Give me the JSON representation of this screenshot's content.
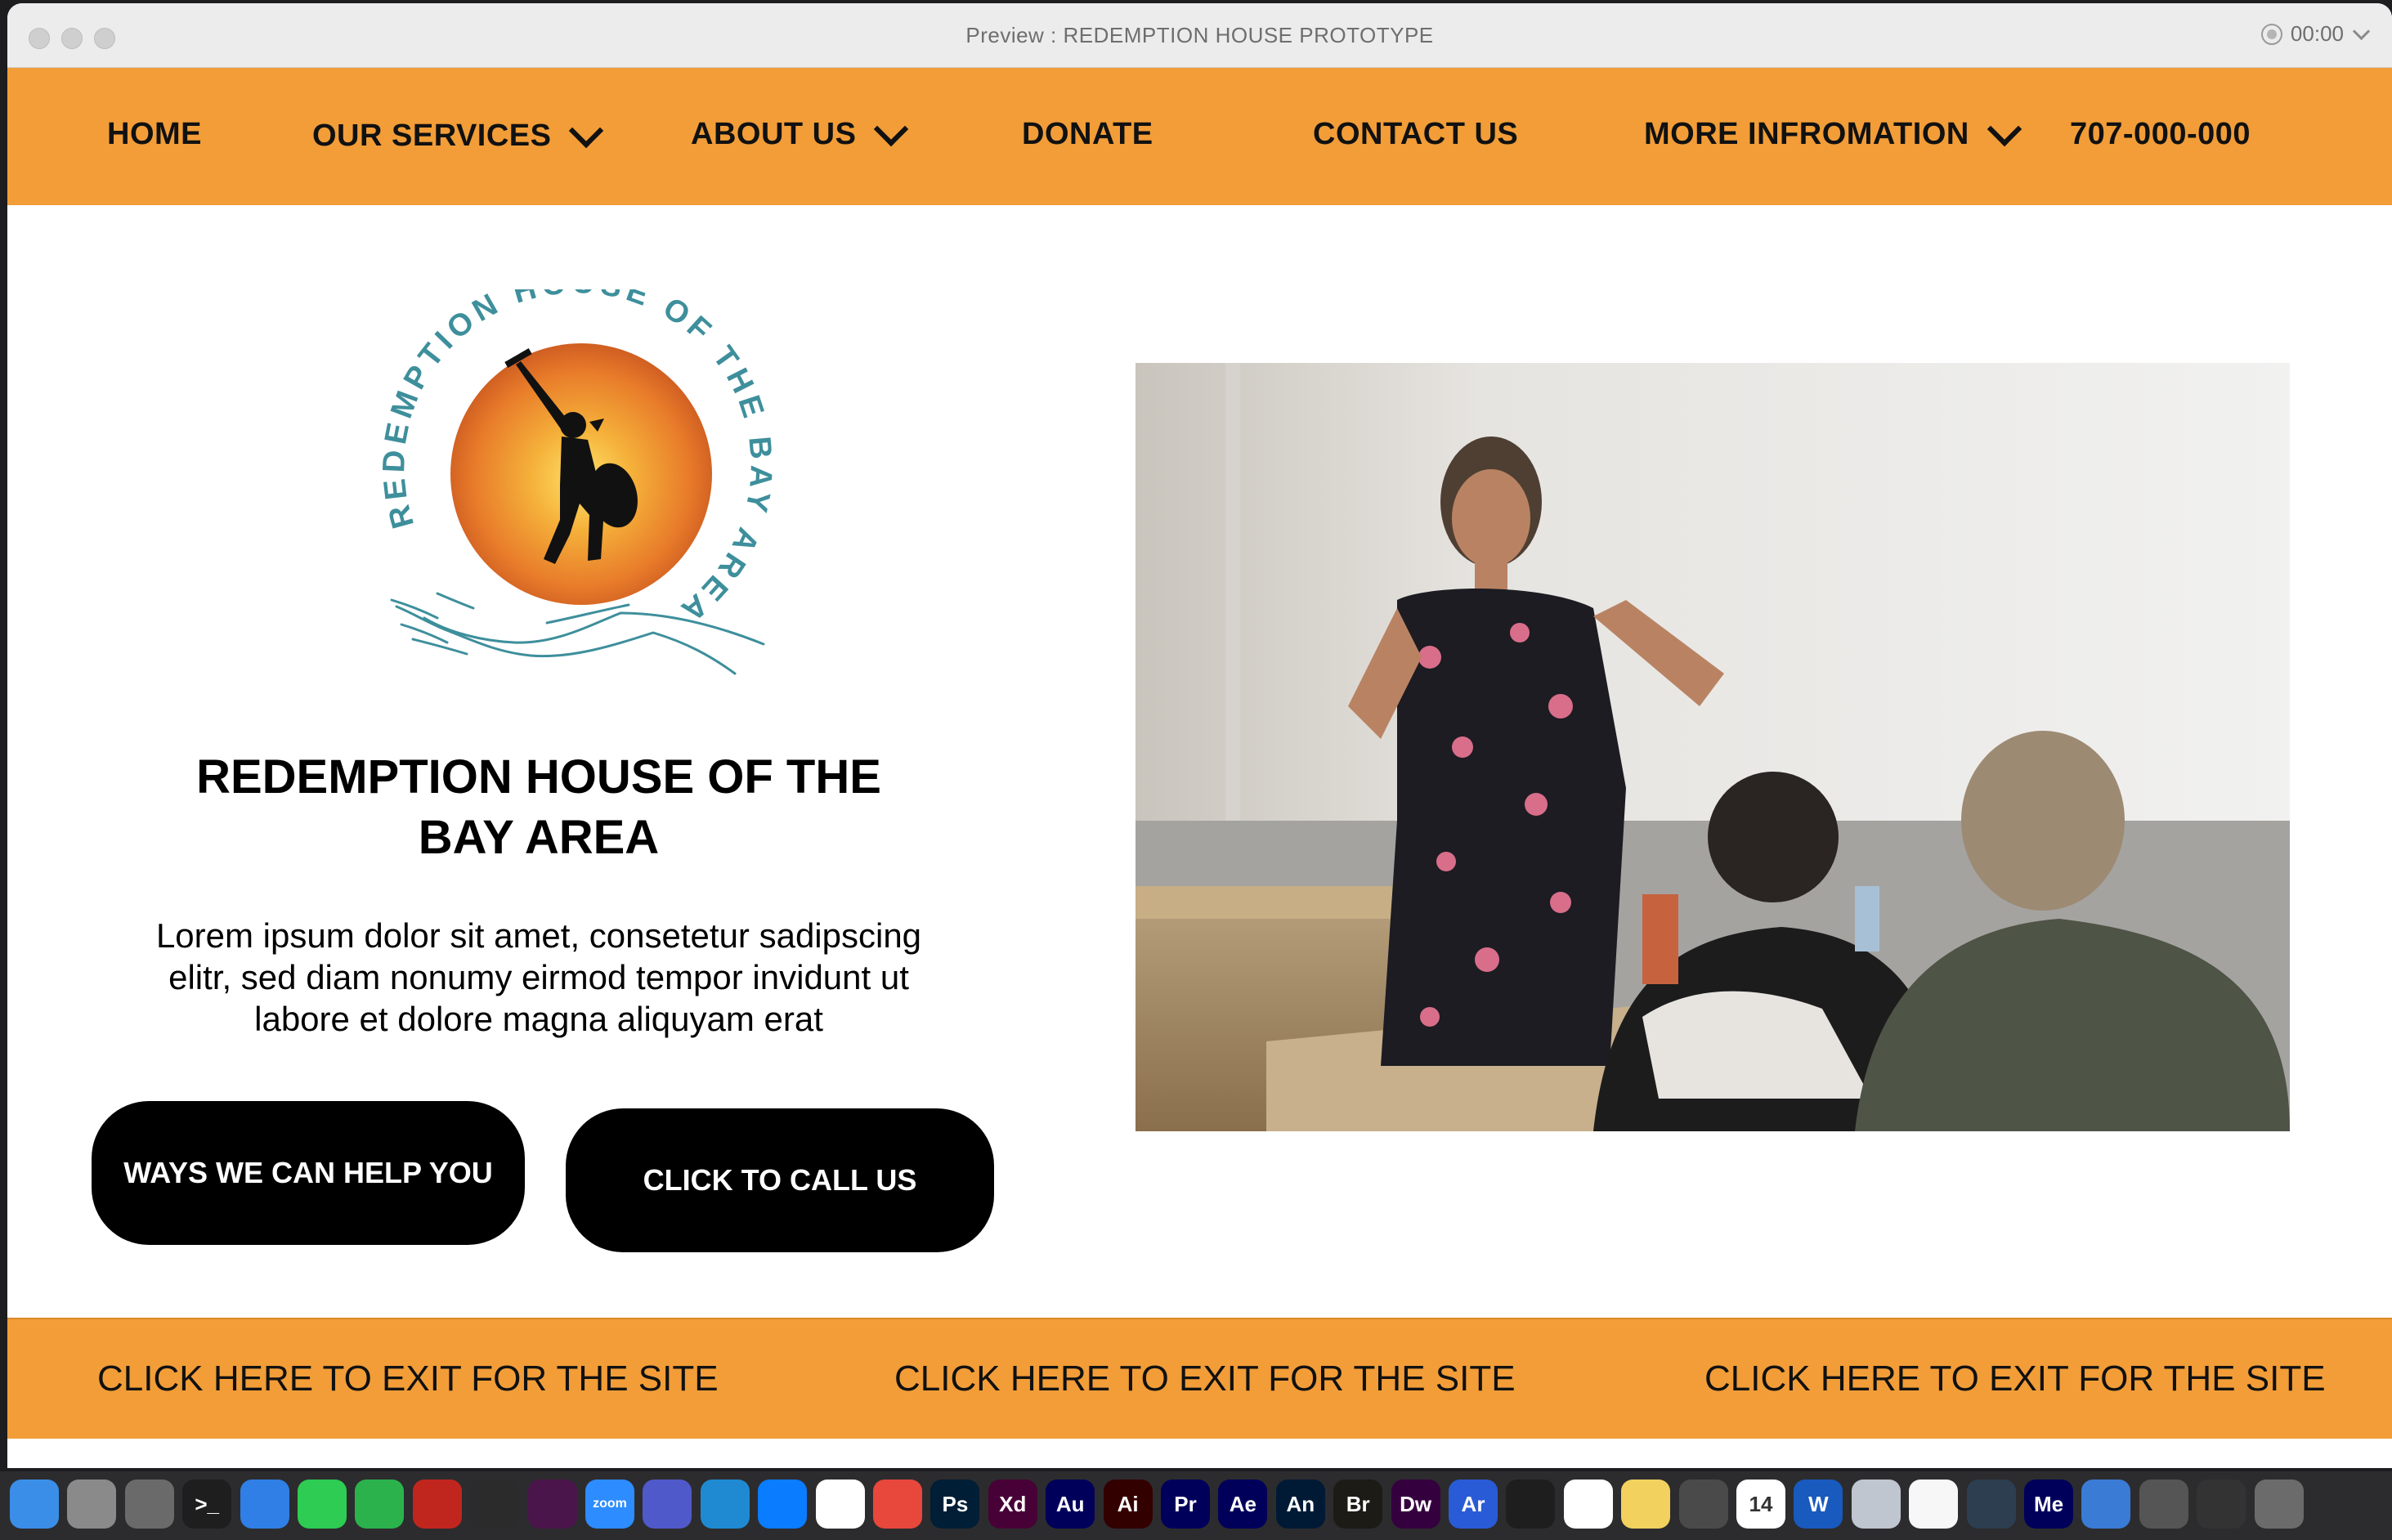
{
  "window": {
    "title": "Preview : REDEMPTION HOUSE PROTOTYPE",
    "timer": "00:00"
  },
  "nav": {
    "home": "HOME",
    "services": "OUR SERVICES",
    "about": "ABOUT US",
    "donate": "DONATE",
    "contact": "CONTACT US",
    "more": "MORE INFROMATION",
    "phone": "707-000-000"
  },
  "logo": {
    "ring_text": "REDEMPTION HOUSE OF THE BAY AREA"
  },
  "hero": {
    "title_line1": "REDEMPTION HOUSE OF THE",
    "title_line2": "BAY AREA",
    "desc_line1": "Lorem ipsum dolor sit amet, consetetur sadipscing",
    "desc_line2": "elitr, sed diam nonumy eirmod tempor invidunt ut",
    "desc_line3": "labore et dolore magna aliquyam erat",
    "help_button": "WAYS WE CAN HELP YOU",
    "call_button": "CLICK TO CALL US"
  },
  "footer": {
    "exit_1": "CLICK HERE TO EXIT FOR THE SITE",
    "exit_2": "CLICK HERE TO EXIT FOR THE SITE",
    "exit_3": "CLICK HERE TO EXIT FOR THE SITE"
  },
  "colors": {
    "accent": "#f29d38",
    "button": "#000000",
    "logo_teal": "#3e8f9c"
  },
  "dock": {
    "items": [
      {
        "name": "finder-icon",
        "label": ""
      },
      {
        "name": "launchpad-icon",
        "label": ""
      },
      {
        "name": "system-preferences-icon",
        "label": ""
      },
      {
        "name": "terminal-icon",
        "label": ">_"
      },
      {
        "name": "mail-icon",
        "label": ""
      },
      {
        "name": "messages-icon",
        "label": ""
      },
      {
        "name": "facetime-icon",
        "label": ""
      },
      {
        "name": "acrobat-icon",
        "label": ""
      },
      {
        "name": "downloader-icon",
        "label": ""
      },
      {
        "name": "slack-icon",
        "label": ""
      },
      {
        "name": "zoom-icon",
        "label": "zoom"
      },
      {
        "name": "teams-icon",
        "label": ""
      },
      {
        "name": "vscode-icon",
        "label": ""
      },
      {
        "name": "messenger-icon",
        "label": ""
      },
      {
        "name": "chrome-icon",
        "label": ""
      },
      {
        "name": "creative-cloud-icon",
        "label": ""
      },
      {
        "name": "photoshop-icon",
        "label": "Ps"
      },
      {
        "name": "xd-icon",
        "label": "Xd"
      },
      {
        "name": "audition-icon",
        "label": "Au"
      },
      {
        "name": "illustrator-icon",
        "label": "Ai"
      },
      {
        "name": "premiere-icon",
        "label": "Pr"
      },
      {
        "name": "after-effects-icon",
        "label": "Ae"
      },
      {
        "name": "animate-icon",
        "label": "An"
      },
      {
        "name": "bridge-icon",
        "label": "Br"
      },
      {
        "name": "dreamweaver-icon",
        "label": "Dw"
      },
      {
        "name": "aero-icon",
        "label": "Ar"
      },
      {
        "name": "figma-icon",
        "label": ""
      },
      {
        "name": "photos-icon",
        "label": ""
      },
      {
        "name": "notes-icon",
        "label": ""
      },
      {
        "name": "calculator-icon",
        "label": ""
      },
      {
        "name": "calendar-icon",
        "label": "14"
      },
      {
        "name": "word-icon",
        "label": "W"
      },
      {
        "name": "preview-icon",
        "label": ""
      },
      {
        "name": "textedit-icon",
        "label": ""
      },
      {
        "name": "quicktime-icon",
        "label": ""
      },
      {
        "name": "media-encoder-icon",
        "label": "Me"
      },
      {
        "name": "downloads-folder-icon",
        "label": ""
      },
      {
        "name": "recent-items-icon",
        "label": ""
      },
      {
        "name": "printer-icon",
        "label": ""
      },
      {
        "name": "trash-icon",
        "label": ""
      }
    ]
  }
}
